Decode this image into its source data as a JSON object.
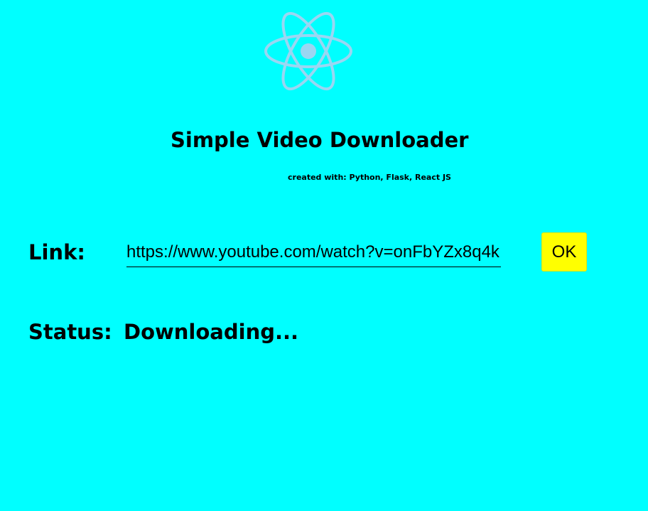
{
  "header": {
    "logo_icon": "react-atom-icon",
    "title": "Simple Video Downloader",
    "subtitle": "created with: Python, Flask, React JS"
  },
  "form": {
    "link_label": "Link:",
    "link_value": "https://www.youtube.com/watch?v=onFbYZx8q4k",
    "ok_label": "OK"
  },
  "status": {
    "label": "Status:",
    "value": "Downloading..."
  },
  "colors": {
    "background": "#00ffff",
    "logo": "#8fd3f4",
    "button": "#ffff00"
  }
}
